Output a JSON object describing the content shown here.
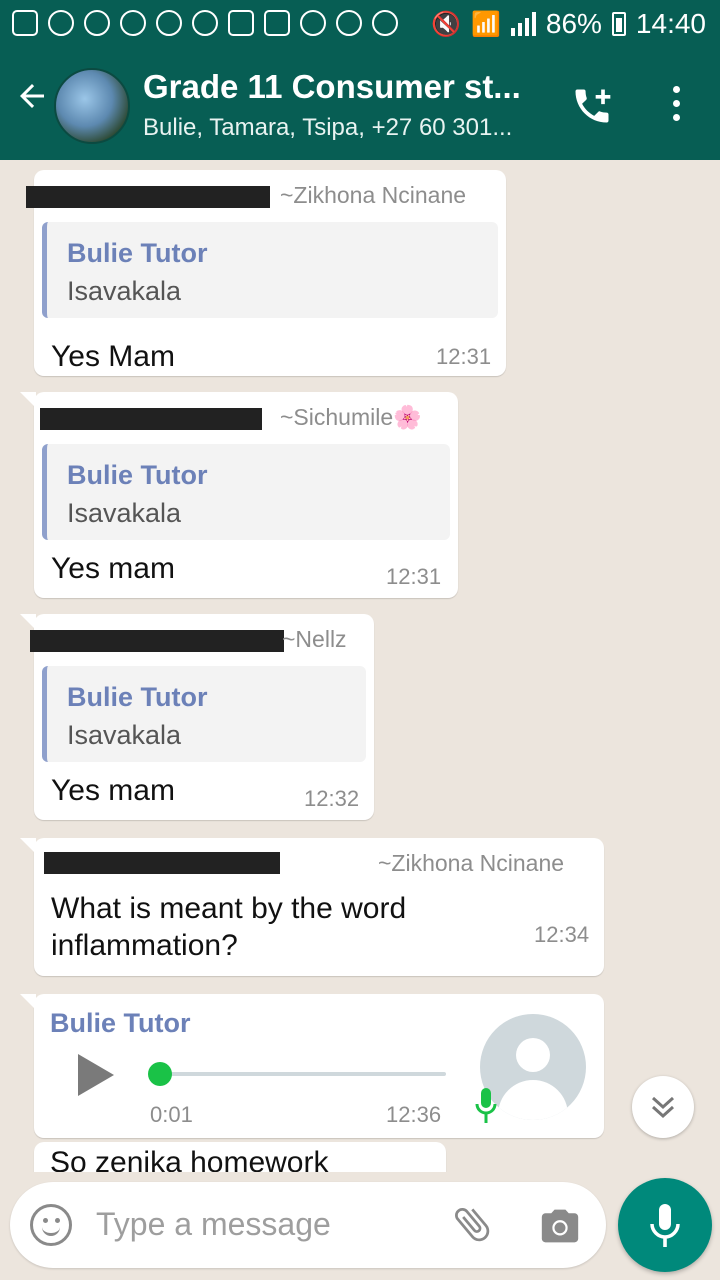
{
  "status_bar": {
    "battery": "86%",
    "time": "14:40"
  },
  "header": {
    "title": "Grade 11 Consumer st...",
    "subtitle": "Bulie, Tamara, Tsipa, +27 60 301..."
  },
  "messages": [
    {
      "sender": "~Zikhona Ncinane",
      "quote_name": "Bulie Tutor",
      "quote_text": "Isavakala",
      "text": "Yes Mam",
      "time": "12:31"
    },
    {
      "sender": "~Sichumile🌸",
      "quote_name": "Bulie Tutor",
      "quote_text": "Isavakala",
      "text": "Yes mam",
      "time": "12:31"
    },
    {
      "sender": "~Nellz",
      "quote_name": "Bulie Tutor",
      "quote_text": "Isavakala",
      "text": "Yes mam",
      "time": "12:32"
    },
    {
      "sender": "~Zikhona Ncinane",
      "text": "What is meant by the word inflammation?",
      "time": "12:34"
    },
    {
      "sender": "Bulie Tutor",
      "type": "voice",
      "duration": "0:01",
      "time": "12:36",
      "progress": 0
    },
    {
      "text": "So zenika homework"
    }
  ],
  "input": {
    "placeholder": "Type a message"
  },
  "colors": {
    "header": "#075e54",
    "background": "#ece5dd",
    "quote_name": "#6c81b8",
    "mic_button": "#00897b",
    "voice_knob": "#1ac247"
  },
  "icons": [
    "back-arrow-icon",
    "add-call-icon",
    "more-vert-icon",
    "play-icon",
    "mic-icon",
    "scroll-down-icon",
    "emoji-icon",
    "attach-icon",
    "camera-icon"
  ]
}
